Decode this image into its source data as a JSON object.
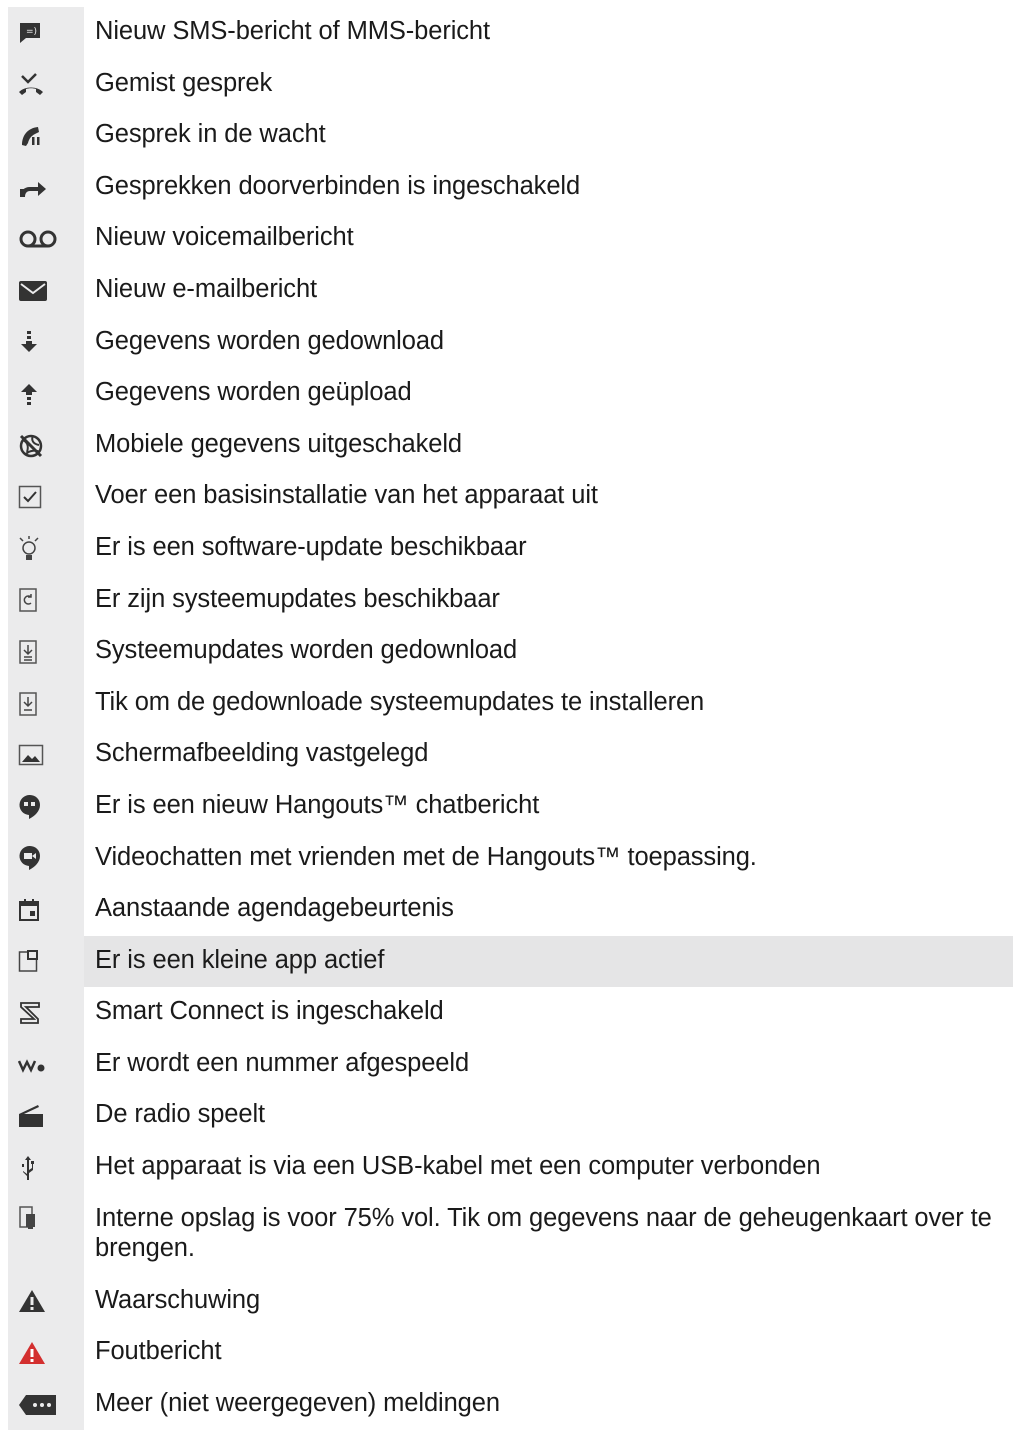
{
  "items": [
    {
      "icon": "sms-icon",
      "text": "Nieuw SMS-bericht of MMS-bericht"
    },
    {
      "icon": "missed-call-icon",
      "text": "Gemist gesprek"
    },
    {
      "icon": "call-on-hold-icon",
      "text": "Gesprek in de wacht"
    },
    {
      "icon": "call-forward-icon",
      "text": "Gesprekken doorverbinden is ingeschakeld"
    },
    {
      "icon": "voicemail-icon",
      "text": "Nieuw voicemailbericht"
    },
    {
      "icon": "email-icon",
      "text": "Nieuw e-mailbericht"
    },
    {
      "icon": "download-icon",
      "text": "Gegevens worden gedownload"
    },
    {
      "icon": "upload-icon",
      "text": "Gegevens worden geüpload"
    },
    {
      "icon": "mobile-data-off-icon",
      "text": "Mobiele gegevens uitgeschakeld"
    },
    {
      "icon": "checkbox-icon",
      "text": "Voer een basisinstallatie van het apparaat uit"
    },
    {
      "icon": "lightbulb-icon",
      "text": "Er is een software-update beschikbaar"
    },
    {
      "icon": "system-update-icon",
      "text": "Er zijn systeemupdates beschikbaar"
    },
    {
      "icon": "system-update-download-icon",
      "text": "Systeemupdates worden gedownload"
    },
    {
      "icon": "install-update-icon",
      "text": "Tik om de gedownloade systeemupdates te installeren"
    },
    {
      "icon": "screenshot-icon",
      "text": "Schermafbeelding vastgelegd"
    },
    {
      "icon": "hangouts-chat-icon",
      "text": "Er is een nieuw Hangouts™ chatbericht"
    },
    {
      "icon": "hangouts-video-icon",
      "text": "Videochatten met vrienden met de Hangouts™ toepassing."
    },
    {
      "icon": "calendar-icon",
      "text": "Aanstaande agendagebeurtenis"
    },
    {
      "icon": "small-app-icon",
      "text": "Er is een kleine app actief",
      "highlight": true
    },
    {
      "icon": "smart-connect-icon",
      "text": "Smart Connect is ingeschakeld"
    },
    {
      "icon": "walkman-icon",
      "text": "Er wordt een nummer afgespeeld"
    },
    {
      "icon": "radio-icon",
      "text": "De radio speelt"
    },
    {
      "icon": "usb-icon",
      "text": "Het apparaat is via een USB-kabel met een computer verbonden"
    },
    {
      "icon": "storage-icon",
      "text": "Interne opslag is voor 75% vol. Tik om gegevens naar de geheugenkaart over te brengen."
    },
    {
      "icon": "warning-icon",
      "text": "Waarschuwing"
    },
    {
      "icon": "error-icon",
      "text": "Foutbericht"
    },
    {
      "icon": "more-notifications-icon",
      "text": "Meer (niet weergegeven) meldingen"
    }
  ],
  "colors": {
    "icon": "#333333",
    "error": "#d32f2f",
    "row_bg": "#ebebec"
  }
}
